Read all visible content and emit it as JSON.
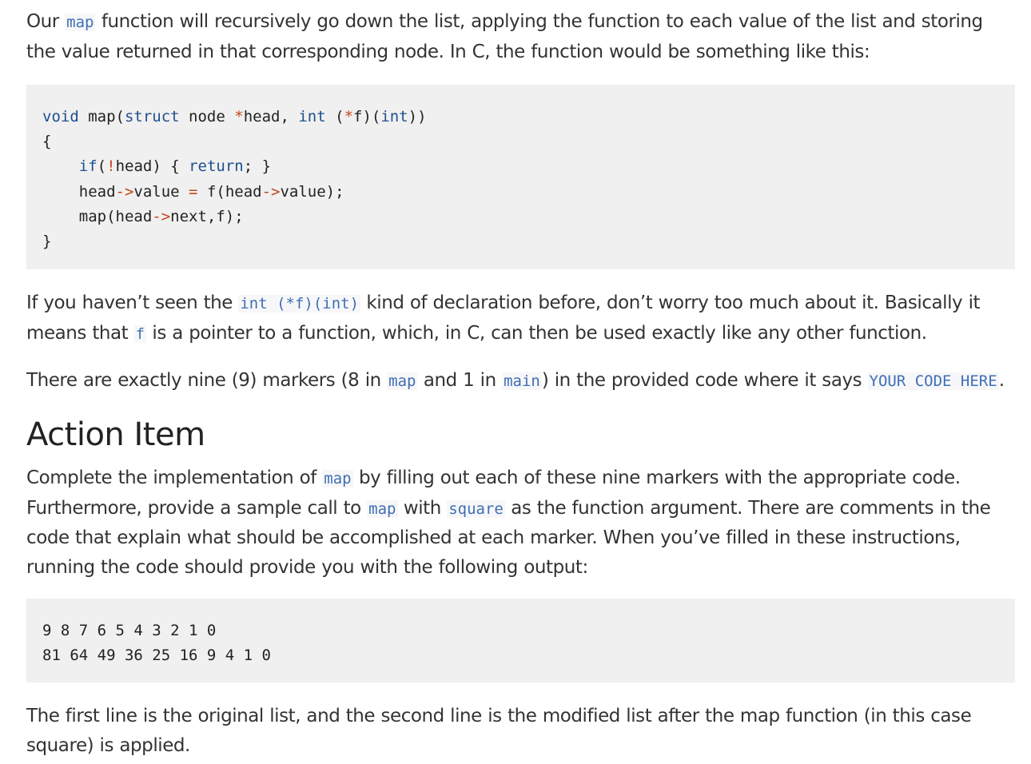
{
  "intro": {
    "t1": "Our ",
    "c1": "map",
    "t2": " function will recursively go down the list, applying the function to each value of the list and storing the value returned in that corresponding node. In C, the function would be something like this:"
  },
  "map_code": {
    "line1": "void map(struct node *head, int (*f)(int))",
    "line2": "{",
    "line3": "    if(!head) { return; }",
    "line4": "    head->value = f(head->value);",
    "line5": "    map(head->next,f);",
    "line6": "}"
  },
  "decl_para": {
    "t1": "If you haven’t seen the ",
    "c1": "int (*f)(int)",
    "t2": " kind of declaration before, don’t worry too much about it. Basically it means that ",
    "c2": "f",
    "t3": " is a pointer to a function, which, in C, can then be used exactly like any other function."
  },
  "markers_para": {
    "t1": "There are exactly nine (9) markers (8 in ",
    "c1": "map",
    "t2": " and 1 in ",
    "c2": "main",
    "t3": ") in the provided code where it says ",
    "c3": "YOUR CODE HERE",
    "t4": "."
  },
  "action_heading": "Action Item",
  "action_para": {
    "t1": "Complete the implementation of ",
    "c1": "map",
    "t2": " by filling out each of these nine markers with the appropriate code. Furthermore, provide a sample call to ",
    "c2": "map",
    "t3": " with ",
    "c3": "square",
    "t4": " as the function argument. There are comments in the code that explain what should be accomplished at each marker. When you’ve filled in these instructions, running the code should provide you with the following output:"
  },
  "output_code": {
    "line1": "9 8 7 6 5 4 3 2 1 0",
    "line2": "81 64 49 36 25 16 9 4 1 0"
  },
  "final_para": "The first line is the original list, and the second line is the modified list after the map function (in this case square) is applied."
}
